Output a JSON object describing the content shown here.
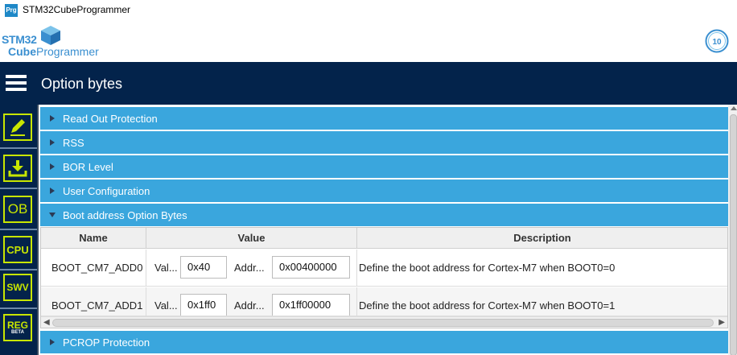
{
  "window": {
    "icon_text": "Prg",
    "title": "STM32CubeProgrammer"
  },
  "logo": {
    "line1": "STM32",
    "line2_bold": "Cube",
    "line2_rest": "Programmer"
  },
  "header": {
    "title": "Option bytes"
  },
  "sidebar": {
    "items": [
      {
        "label": "",
        "icon": "edit-icon"
      },
      {
        "label": "",
        "icon": "download-icon"
      },
      {
        "label": "OB",
        "icon": "option-bytes-icon"
      },
      {
        "label": "CPU",
        "icon": "cpu-icon"
      },
      {
        "label": "SWV",
        "icon": "swv-icon"
      },
      {
        "label": "REG",
        "sublabel": "BETA",
        "icon": "register-icon"
      }
    ]
  },
  "sections": [
    {
      "label": "Read Out Protection",
      "expanded": false
    },
    {
      "label": "RSS",
      "expanded": false
    },
    {
      "label": "BOR Level",
      "expanded": false
    },
    {
      "label": "User Configuration",
      "expanded": false
    },
    {
      "label": "Boot address Option Bytes",
      "expanded": true
    },
    {
      "label": "PCROP Protection",
      "expanded": false
    }
  ],
  "table": {
    "headers": {
      "name": "Name",
      "value": "Value",
      "description": "Description"
    },
    "rows": [
      {
        "name": "BOOT_CM7_ADD0",
        "value_label": "Val...",
        "value": "0x40",
        "addr_label": "Addr...",
        "addr": "0x00400000",
        "description": "Define the boot address for Cortex-M7 when BOOT0=0"
      },
      {
        "name": "BOOT_CM7_ADD1",
        "value_label": "Val...",
        "value": "0x1ff0",
        "addr_label": "Addr...",
        "addr": "0x1ff00000",
        "description": "Define the boot address for Cortex-M7 when BOOT0=1"
      }
    ]
  },
  "colors": {
    "header_bg": "#03234b",
    "section_bg": "#3aa6dd",
    "sidebar_accent": "#c8e600"
  }
}
